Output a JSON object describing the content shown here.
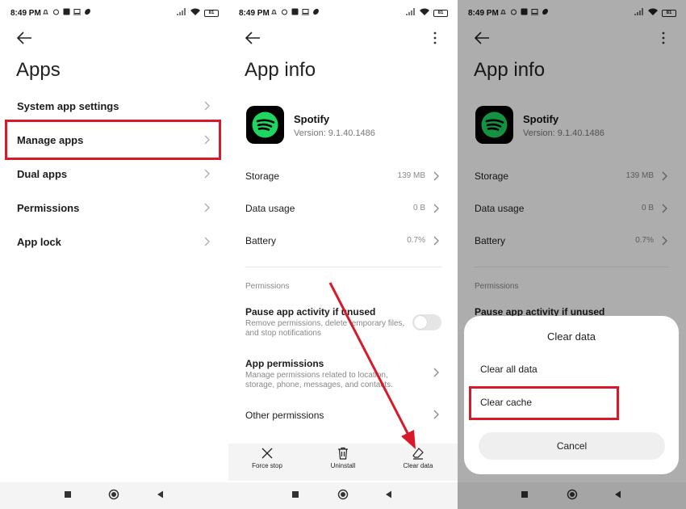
{
  "status_bar": {
    "time": "8:49 PM",
    "battery": "81"
  },
  "panel1": {
    "title": "Apps",
    "items": [
      {
        "label": "System app settings"
      },
      {
        "label": "Manage apps"
      },
      {
        "label": "Dual apps"
      },
      {
        "label": "Permissions"
      },
      {
        "label": "App lock"
      }
    ]
  },
  "app_info": {
    "title": "App info",
    "app_name": "Spotify",
    "version": "Version: 9.1.40.1486",
    "rows": [
      {
        "label": "Storage",
        "value": "139 MB"
      },
      {
        "label": "Data usage",
        "value": "0 B"
      },
      {
        "label": "Battery",
        "value": "0.7%"
      }
    ],
    "permissions_header": "Permissions",
    "pause_title": "Pause app activity if unused",
    "pause_desc": "Remove permissions, delete temporary files, and stop notifications",
    "app_permissions_title": "App permissions",
    "app_permissions_desc": "Manage permissions related to location, storage, phone, messages, and contacts.",
    "other_permissions": "Other permissions",
    "pause_toggle_on": false
  },
  "action_bar": {
    "force_stop": "Force stop",
    "uninstall": "Uninstall",
    "clear_data": "Clear data"
  },
  "dialog": {
    "title": "Clear data",
    "option_all": "Clear all data",
    "option_cache": "Clear cache",
    "cancel": "Cancel"
  },
  "colors": {
    "highlight": "#d7192a",
    "arrow": "#d7192a",
    "spotify_green": "#1ed760"
  }
}
